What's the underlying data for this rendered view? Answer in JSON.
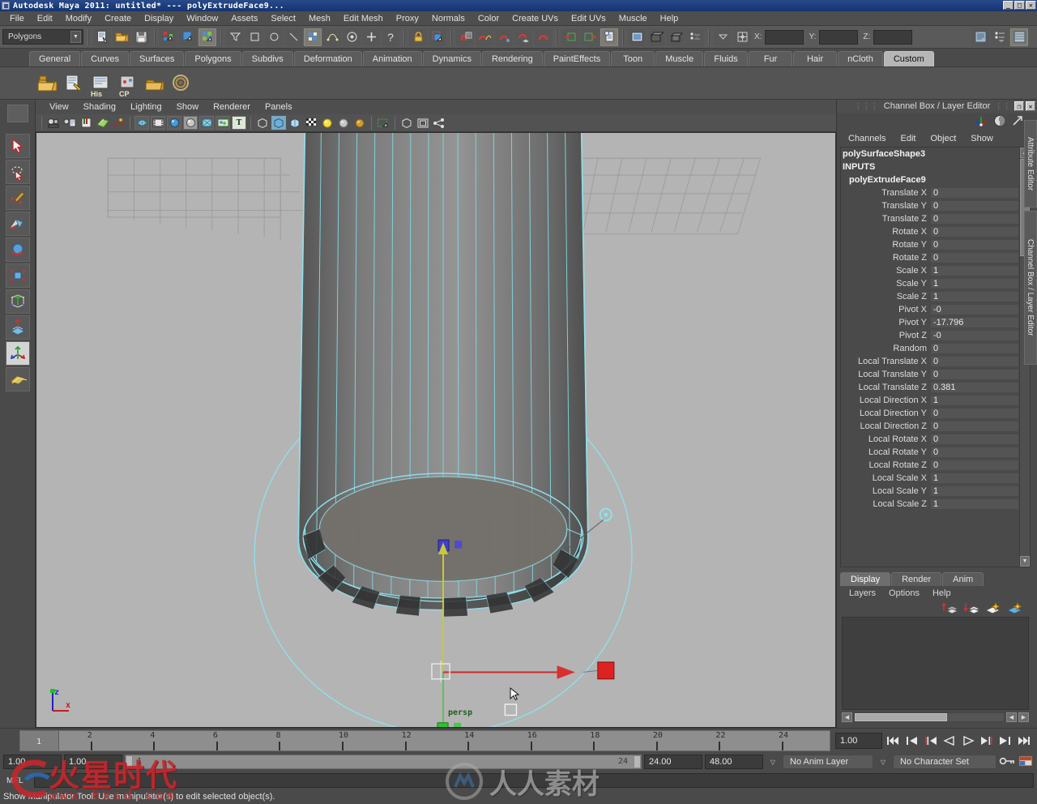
{
  "titlebar": {
    "text": "Autodesk Maya 2011: untitled*    ---    polyExtrudeFace9...",
    "minimize": "_",
    "maximize": "□",
    "close": "✕"
  },
  "menubar": {
    "items": [
      "File",
      "Edit",
      "Modify",
      "Create",
      "Display",
      "Window",
      "Assets",
      "Select",
      "Mesh",
      "Edit Mesh",
      "Proxy",
      "Normals",
      "Color",
      "Create UVs",
      "Edit UVs",
      "Muscle",
      "Help"
    ]
  },
  "statusline": {
    "menuset": "Polygons",
    "coord_labels": [
      "X:",
      "Y:",
      "Z:"
    ],
    "coord_values": [
      "",
      "",
      ""
    ],
    "icons": [
      "new-scene-icon",
      "open-scene-icon",
      "save-scene-icon",
      "select-by-hierarchy-icon",
      "select-by-object-icon",
      "select-by-component-icon",
      "select-filter-icon",
      "select-rect-icon",
      "select-circle-icon",
      "select-line-icon",
      "component-mask-icon",
      "curve-point-icon",
      "pivot-point-icon",
      "add-icon",
      "help-icon",
      "lock-icon",
      "highlight-selection-icon",
      "snap-grid-icon",
      "snap-curve-icon",
      "snap-point-icon",
      "snap-view-plane-icon",
      "snap-live-icon",
      "input-connection-icon",
      "output-connection-icon",
      "construction-history-icon",
      "render-current-frame-icon",
      "render-sequence-icon",
      "render-batch-icon",
      "render-globals-icon",
      "hypershade-icon",
      "field-toggle-icon",
      "attribute-editor-toggle-icon",
      "tool-settings-toggle-icon",
      "channel-box-toggle-icon"
    ]
  },
  "shelf": {
    "tabs": [
      "General",
      "Curves",
      "Surfaces",
      "Polygons",
      "Subdivs",
      "Deformation",
      "Animation",
      "Dynamics",
      "Rendering",
      "PaintEffects",
      "Toon",
      "Muscle",
      "Fluids",
      "Fur",
      "Hair",
      "nCloth",
      "Custom"
    ],
    "active_tab": "Custom",
    "icons": [
      "folder-stack-icon",
      "script-editor-icon",
      "history-icon",
      "control-point-icon",
      "package-icon",
      "coil-icon"
    ],
    "icon_labels": [
      "",
      "",
      "His",
      "CP",
      "",
      ""
    ]
  },
  "toolbox": {
    "items": [
      "select-tool-icon",
      "lasso-tool-icon",
      "paint-select-tool-icon",
      "move-tool-icon",
      "rotate-tool-icon",
      "scale-tool-icon",
      "universal-manipulator-icon",
      "soft-modification-icon",
      "show-manipulator-icon",
      "last-tool-icon",
      "transform-grid-icon",
      "component-editor-icon",
      "outliner-icon",
      "graph-editor-icon",
      "dope-sheet-icon",
      "hypergraph-icon",
      "render-view-icon",
      "unfold-icon"
    ],
    "selected": "show-manipulator-icon"
  },
  "viewport": {
    "menus": [
      "View",
      "Shading",
      "Lighting",
      "Show",
      "Renderer",
      "Panels"
    ],
    "toolbar_icons": [
      "camera-select-icon",
      "camera-attributes-icon",
      "bookmark-icon",
      "image-plane-icon",
      "keyframe-icon",
      "wireframe-shading-icon",
      "film-gate-icon",
      "smooth-shade-all-icon",
      "smooth-shade-selected-icon",
      "flat-shade-icon",
      "hardware-texture-icon",
      "wireframe-on-shaded-icon",
      "xray-icon",
      "xray-joints-icon",
      "default-light-icon",
      "lights-icon",
      "all-lights-icon",
      "shadows-icon",
      "exposure-icon",
      "isolate-select-icon",
      "grid-toggle-icon",
      "film-gate-toggle-icon",
      "resolution-gate-icon",
      "share-icon"
    ],
    "camera_label": "persp",
    "axis_labels": {
      "x": "x",
      "z": "z"
    },
    "background_color": "#b4b4b4",
    "mesh_wire_color": "#7fd6e0",
    "manipulator_colors": {
      "x": "#e02020",
      "y": "#d8d820",
      "z": "#2020e0",
      "center": "#20c020"
    }
  },
  "channelbox": {
    "panel_title": "Channel Box / Layer Editor",
    "restore_btn": "❐",
    "close_btn": "✕",
    "menus": [
      "Channels",
      "Edit",
      "Object",
      "Show"
    ],
    "header_icons": [
      "manipulator-axis-icon",
      "clock-icon",
      "arrow-icon"
    ],
    "object_name": "polySurfaceShape3",
    "inputs_label": "INPUTS",
    "node_name": "polyExtrudeFace9",
    "attributes": [
      {
        "name": "Translate X",
        "value": "0"
      },
      {
        "name": "Translate Y",
        "value": "0"
      },
      {
        "name": "Translate Z",
        "value": "0"
      },
      {
        "name": "Rotate X",
        "value": "0"
      },
      {
        "name": "Rotate Y",
        "value": "0"
      },
      {
        "name": "Rotate Z",
        "value": "0"
      },
      {
        "name": "Scale X",
        "value": "1"
      },
      {
        "name": "Scale Y",
        "value": "1"
      },
      {
        "name": "Scale Z",
        "value": "1"
      },
      {
        "name": "Pivot X",
        "value": "-0"
      },
      {
        "name": "Pivot Y",
        "value": "-17.796"
      },
      {
        "name": "Pivot Z",
        "value": "-0"
      },
      {
        "name": "Random",
        "value": "0"
      },
      {
        "name": "Local Translate X",
        "value": "0"
      },
      {
        "name": "Local Translate Y",
        "value": "0"
      },
      {
        "name": "Local Translate Z",
        "value": "0.381"
      },
      {
        "name": "Local Direction X",
        "value": "1"
      },
      {
        "name": "Local Direction Y",
        "value": "0"
      },
      {
        "name": "Local Direction Z",
        "value": "0"
      },
      {
        "name": "Local Rotate X",
        "value": "0"
      },
      {
        "name": "Local Rotate Y",
        "value": "0"
      },
      {
        "name": "Local Rotate Z",
        "value": "0"
      },
      {
        "name": "Local Scale X",
        "value": "1"
      },
      {
        "name": "Local Scale Y",
        "value": "1"
      },
      {
        "name": "Local Scale Z",
        "value": "1"
      }
    ],
    "side_tabs": [
      "Attribute Editor",
      "Channel Box / Layer Editor"
    ]
  },
  "layereditor": {
    "tabs": [
      "Display",
      "Render",
      "Anim"
    ],
    "active_tab": "Display",
    "menus": [
      "Layers",
      "Options",
      "Help"
    ],
    "buttons": [
      "move-layer-up-icon",
      "move-layer-down-icon",
      "new-layer-icon",
      "new-layer-from-selected-icon"
    ]
  },
  "timeslider": {
    "current_frame": "1",
    "ticks": [
      "2",
      "4",
      "6",
      "8",
      "10",
      "12",
      "14",
      "16",
      "18",
      "20",
      "22",
      "24"
    ],
    "current_time_field": "1.00",
    "playback_buttons": [
      "go-to-start-icon",
      "step-back-frame-icon",
      "step-back-key-icon",
      "play-backwards-icon",
      "play-forwards-icon",
      "step-forward-key-icon",
      "step-forward-frame-icon",
      "go-to-end-icon"
    ]
  },
  "rangeslider": {
    "anim_start": "1.00",
    "range_start": "1.00",
    "bar_start_label": "1",
    "bar_end_label": "24",
    "range_end": "24.00",
    "anim_end": "48.00",
    "anim_layer": "No Anim Layer",
    "character_set": "No Character Set",
    "key_icon": "auto-key-icon",
    "prefs_icon": "animation-preferences-icon"
  },
  "commandline": {
    "mel_label": "MEL",
    "input_value": "",
    "help_text": "Show Manipulator Tool: Use manipulator(s) to edit selected object(s)."
  },
  "watermarks": {
    "left_cn": "火星时代",
    "left_url": "www.hxsd.com",
    "right_cn": "人人素材"
  }
}
